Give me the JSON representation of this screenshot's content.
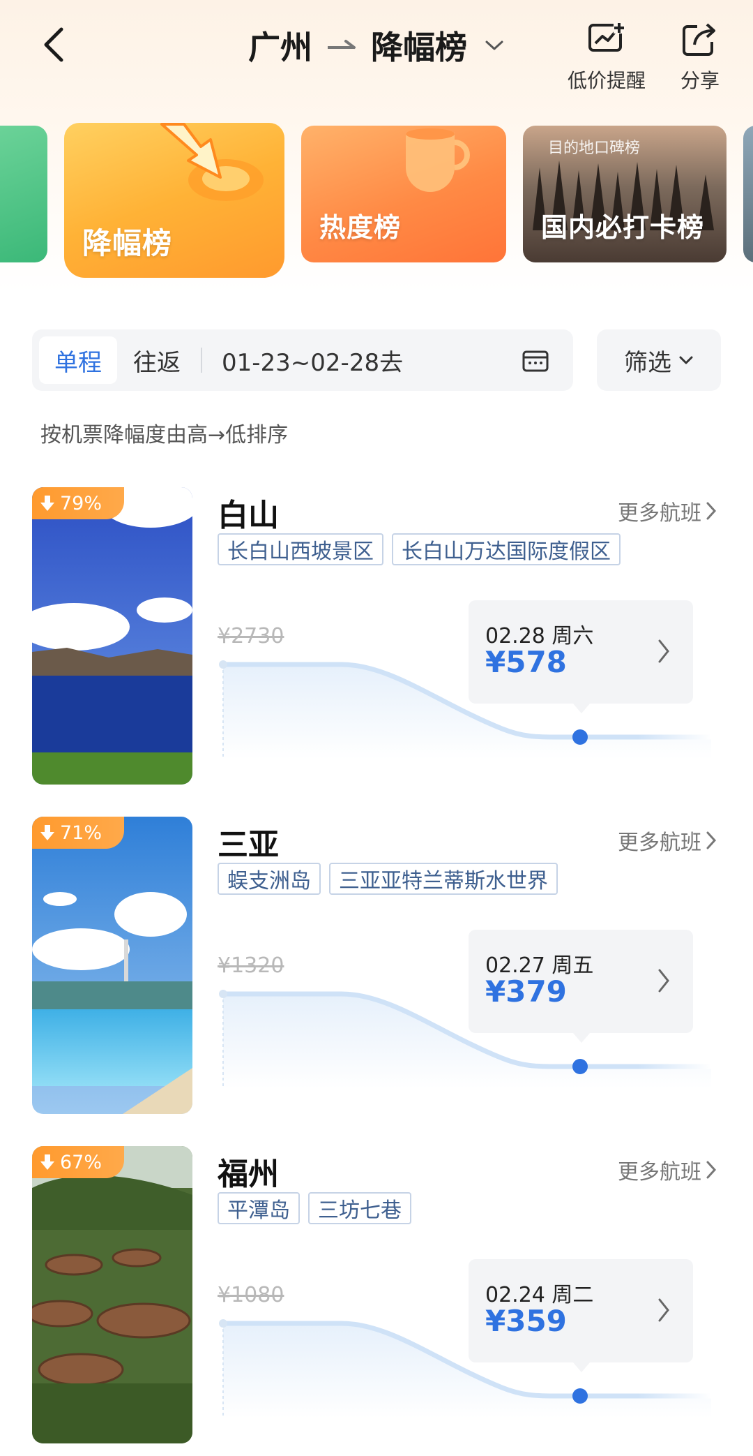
{
  "header": {
    "origin": "广州",
    "list_name": "降幅榜",
    "actions": [
      {
        "label": "低价提醒",
        "icon": "price-alert-icon"
      },
      {
        "label": "分享",
        "icon": "share-icon"
      }
    ]
  },
  "rank_cards": [
    {
      "label": "降幅榜",
      "selected": true
    },
    {
      "label": "热度榜",
      "selected": false
    },
    {
      "label": "国内必打卡榜",
      "badge": "目的地口碑榜",
      "selected": false
    }
  ],
  "trip": {
    "tabs": [
      "单程",
      "往返"
    ],
    "active_tab": "单程",
    "date_range": "01-23~02-28去",
    "filter_label": "筛选"
  },
  "sort_hint": "按机票降幅度由高→低排序",
  "more_flights_label": "更多航班",
  "destinations": [
    {
      "name": "白山",
      "drop": "79%",
      "tags": [
        "长白山西坡景区",
        "长白山万达国际度假区"
      ],
      "original_price": "¥2730",
      "date": "02.28 周六",
      "price": "¥578"
    },
    {
      "name": "三亚",
      "drop": "71%",
      "tags": [
        "蜈支洲岛",
        "三亚亚特兰蒂斯水世界"
      ],
      "original_price": "¥1320",
      "date": "02.27 周五",
      "price": "¥379"
    },
    {
      "name": "福州",
      "drop": "67%",
      "tags": [
        "平潭岛",
        "三坊七巷"
      ],
      "original_price": "¥1080",
      "date": "02.24 周二",
      "price": "¥359"
    }
  ],
  "colors": {
    "accent_blue": "#2f72e0",
    "badge_orange": "#ff9a2e",
    "trend_line": "#cfe2f7",
    "trend_dot": "#2f72e0"
  }
}
